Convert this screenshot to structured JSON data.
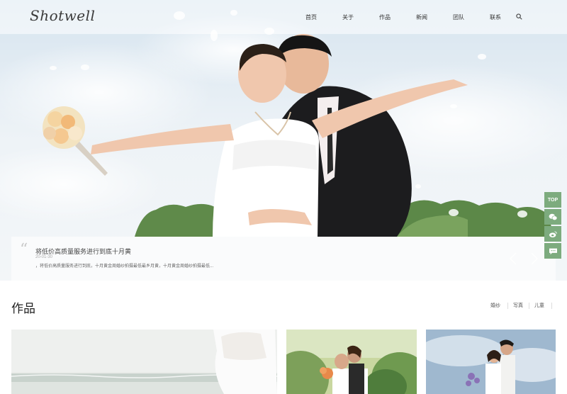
{
  "brand": {
    "logo_text": "Shotwell"
  },
  "nav": {
    "items": [
      "首页",
      "关于",
      "作品",
      "新闻",
      "团队",
      "联系"
    ]
  },
  "slider": {
    "title": "将低价高质量服务进行到底十月黄",
    "date": "20-01-30",
    "description": "，将低价高质量服务进行到底，十月黄金周婚纱拍摄最低最乡月黄，十月黄金周婚纱拍摄最低..."
  },
  "float_bar": {
    "top_label": "TOP",
    "icons": [
      "wechat-icon",
      "weibo-icon",
      "chat-icon"
    ],
    "color": "#7dab7e"
  },
  "works": {
    "section_title": "作品",
    "filters": [
      "婚纱",
      "写真",
      "儿童"
    ]
  }
}
